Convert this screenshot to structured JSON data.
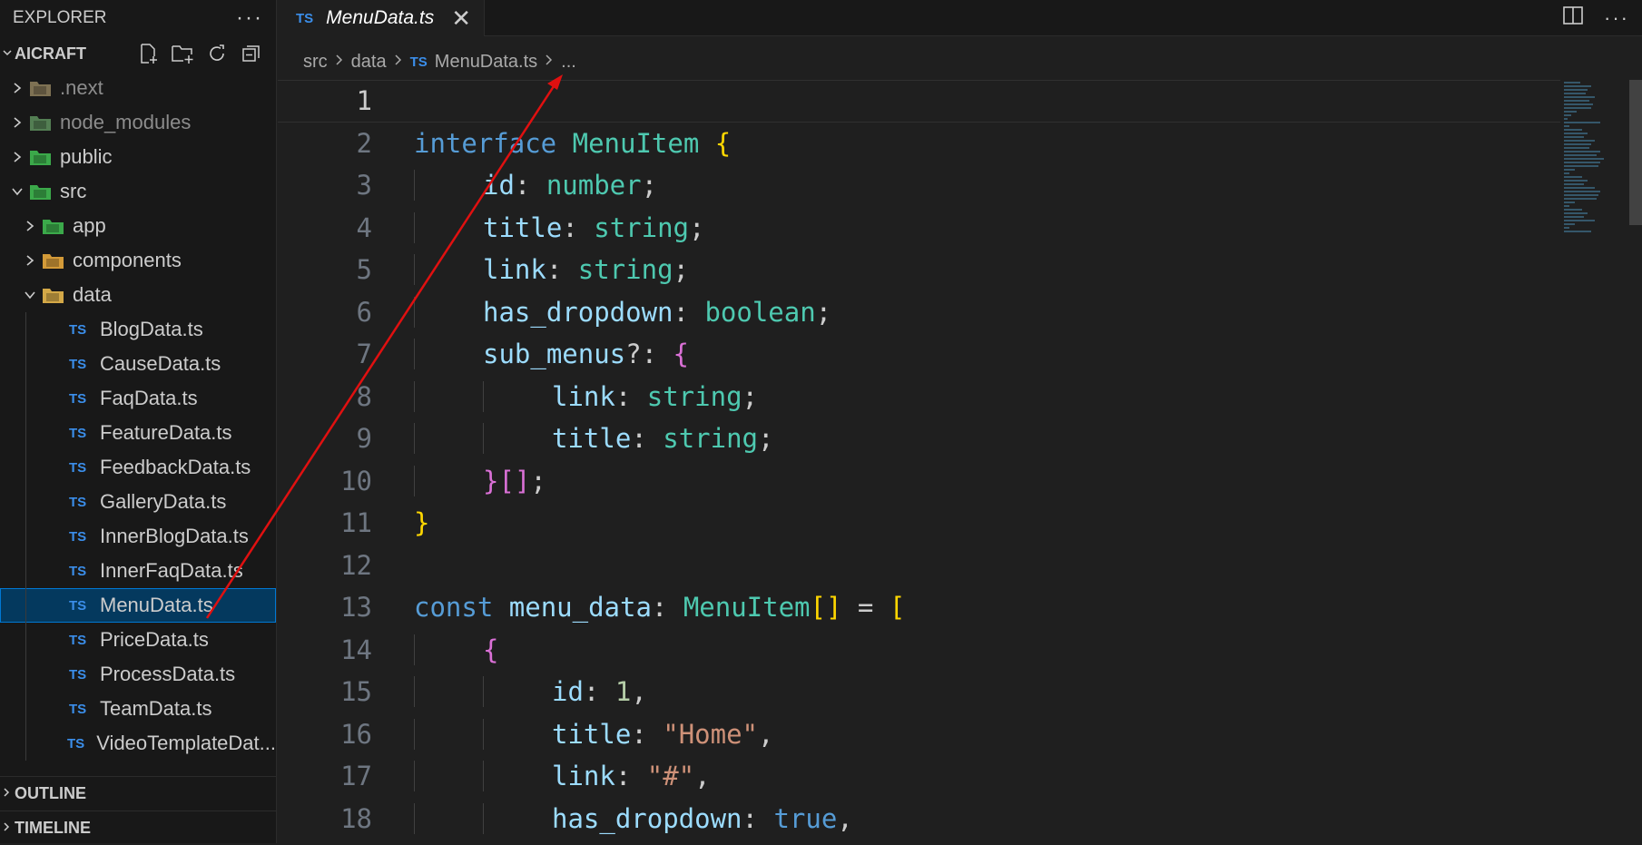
{
  "sidebar": {
    "title": "EXPLORER",
    "more": "···",
    "project": "AICRAFT",
    "tree": [
      {
        "label": ".next",
        "kind": "folder",
        "depth": 0,
        "open": false,
        "dim": true,
        "icon": "next-folder-icon",
        "color": "#8a7b5a"
      },
      {
        "label": "node_modules",
        "kind": "folder",
        "depth": 0,
        "open": false,
        "dim": true,
        "icon": "node-folder-icon",
        "color": "#5a8a5a"
      },
      {
        "label": "public",
        "kind": "folder",
        "depth": 0,
        "open": false,
        "dim": false,
        "icon": "public-folder-icon",
        "color": "#3fb950"
      },
      {
        "label": "src",
        "kind": "folder",
        "depth": 0,
        "open": true,
        "dim": false,
        "icon": "src-folder-icon",
        "color": "#3fb950"
      },
      {
        "label": "app",
        "kind": "folder",
        "depth": 1,
        "open": false,
        "dim": false,
        "icon": "app-folder-icon",
        "color": "#3fb950"
      },
      {
        "label": "components",
        "kind": "folder",
        "depth": 1,
        "open": false,
        "dim": false,
        "icon": "components-folder-icon",
        "color": "#e8a83c"
      },
      {
        "label": "data",
        "kind": "folder",
        "depth": 1,
        "open": true,
        "dim": false,
        "icon": "data-folder-icon",
        "color": "#e8b84c"
      },
      {
        "label": "BlogData.ts",
        "kind": "file",
        "depth": 2
      },
      {
        "label": "CauseData.ts",
        "kind": "file",
        "depth": 2
      },
      {
        "label": "FaqData.ts",
        "kind": "file",
        "depth": 2
      },
      {
        "label": "FeatureData.ts",
        "kind": "file",
        "depth": 2
      },
      {
        "label": "FeedbackData.ts",
        "kind": "file",
        "depth": 2
      },
      {
        "label": "GalleryData.ts",
        "kind": "file",
        "depth": 2
      },
      {
        "label": "InnerBlogData.ts",
        "kind": "file",
        "depth": 2
      },
      {
        "label": "InnerFaqData.ts",
        "kind": "file",
        "depth": 2
      },
      {
        "label": "MenuData.ts",
        "kind": "file",
        "depth": 2,
        "selected": true
      },
      {
        "label": "PriceData.ts",
        "kind": "file",
        "depth": 2
      },
      {
        "label": "ProcessData.ts",
        "kind": "file",
        "depth": 2
      },
      {
        "label": "TeamData.ts",
        "kind": "file",
        "depth": 2
      },
      {
        "label": "VideoTemplateDat...",
        "kind": "file",
        "depth": 2
      }
    ],
    "ts_badge": "TS",
    "outline": "OUTLINE",
    "timeline": "TIMELINE"
  },
  "tab": {
    "badge": "TS",
    "name": "MenuData.ts",
    "close": "✕"
  },
  "breadcrumb": {
    "parts": [
      "src",
      "data"
    ],
    "badge": "TS",
    "file": "MenuData.ts",
    "more": "..."
  },
  "editor": {
    "current_line": 1,
    "lines": [
      {
        "n": "1",
        "indent": 0,
        "tokens": []
      },
      {
        "n": "2",
        "indent": 0,
        "tokens": [
          [
            "kw",
            "interface"
          ],
          [
            "pu",
            " "
          ],
          [
            "ty",
            "MenuItem"
          ],
          [
            "pu",
            " "
          ],
          [
            "b1",
            "{"
          ]
        ]
      },
      {
        "n": "3",
        "indent": 1,
        "tokens": [
          [
            "pr",
            "id"
          ],
          [
            "pu",
            ": "
          ],
          [
            "ty",
            "number"
          ],
          [
            "pu",
            ";"
          ]
        ]
      },
      {
        "n": "4",
        "indent": 1,
        "tokens": [
          [
            "pr",
            "title"
          ],
          [
            "pu",
            ": "
          ],
          [
            "ty",
            "string"
          ],
          [
            "pu",
            ";"
          ]
        ]
      },
      {
        "n": "5",
        "indent": 1,
        "tokens": [
          [
            "pr",
            "link"
          ],
          [
            "pu",
            ": "
          ],
          [
            "ty",
            "string"
          ],
          [
            "pu",
            ";"
          ]
        ]
      },
      {
        "n": "6",
        "indent": 1,
        "tokens": [
          [
            "pr",
            "has_dropdown"
          ],
          [
            "pu",
            ": "
          ],
          [
            "ty",
            "boolean"
          ],
          [
            "pu",
            ";"
          ]
        ]
      },
      {
        "n": "7",
        "indent": 1,
        "tokens": [
          [
            "pr",
            "sub_menus"
          ],
          [
            "pu",
            "?: "
          ],
          [
            "b2",
            "{"
          ]
        ]
      },
      {
        "n": "8",
        "indent": 2,
        "tokens": [
          [
            "pr",
            "link"
          ],
          [
            "pu",
            ": "
          ],
          [
            "ty",
            "string"
          ],
          [
            "pu",
            ";"
          ]
        ]
      },
      {
        "n": "9",
        "indent": 2,
        "tokens": [
          [
            "pr",
            "title"
          ],
          [
            "pu",
            ": "
          ],
          [
            "ty",
            "string"
          ],
          [
            "pu",
            ";"
          ]
        ]
      },
      {
        "n": "10",
        "indent": 1,
        "tokens": [
          [
            "b2",
            "}[]"
          ],
          [
            "pu",
            ";"
          ]
        ]
      },
      {
        "n": "11",
        "indent": 0,
        "tokens": [
          [
            "b1",
            "}"
          ]
        ]
      },
      {
        "n": "12",
        "indent": 0,
        "tokens": []
      },
      {
        "n": "13",
        "indent": 0,
        "tokens": [
          [
            "kw",
            "const"
          ],
          [
            "pu",
            " "
          ],
          [
            "pr",
            "menu_data"
          ],
          [
            "pu",
            ": "
          ],
          [
            "ty",
            "MenuItem"
          ],
          [
            "b1",
            "[]"
          ],
          [
            "pu",
            " = "
          ],
          [
            "b1",
            "["
          ]
        ]
      },
      {
        "n": "14",
        "indent": 1,
        "tokens": [
          [
            "b2",
            "{"
          ]
        ]
      },
      {
        "n": "15",
        "indent": 2,
        "tokens": [
          [
            "pr",
            "id"
          ],
          [
            "pu",
            ": "
          ],
          [
            "nm",
            "1"
          ],
          [
            "pu",
            ","
          ]
        ]
      },
      {
        "n": "16",
        "indent": 2,
        "tokens": [
          [
            "pr",
            "title"
          ],
          [
            "pu",
            ": "
          ],
          [
            "st",
            "\"Home\""
          ],
          [
            "pu",
            ","
          ]
        ]
      },
      {
        "n": "17",
        "indent": 2,
        "tokens": [
          [
            "pr",
            "link"
          ],
          [
            "pu",
            ": "
          ],
          [
            "st",
            "\"#\""
          ],
          [
            "pu",
            ","
          ]
        ]
      },
      {
        "n": "18",
        "indent": 2,
        "tokens": [
          [
            "pr",
            "has_dropdown"
          ],
          [
            "pu",
            ": "
          ],
          [
            "kw",
            "true"
          ],
          [
            "pu",
            ","
          ]
        ]
      }
    ]
  },
  "colors": {
    "accent": "#0078d4",
    "selection": "#04395e",
    "annotation_arrow": "#e01010"
  }
}
